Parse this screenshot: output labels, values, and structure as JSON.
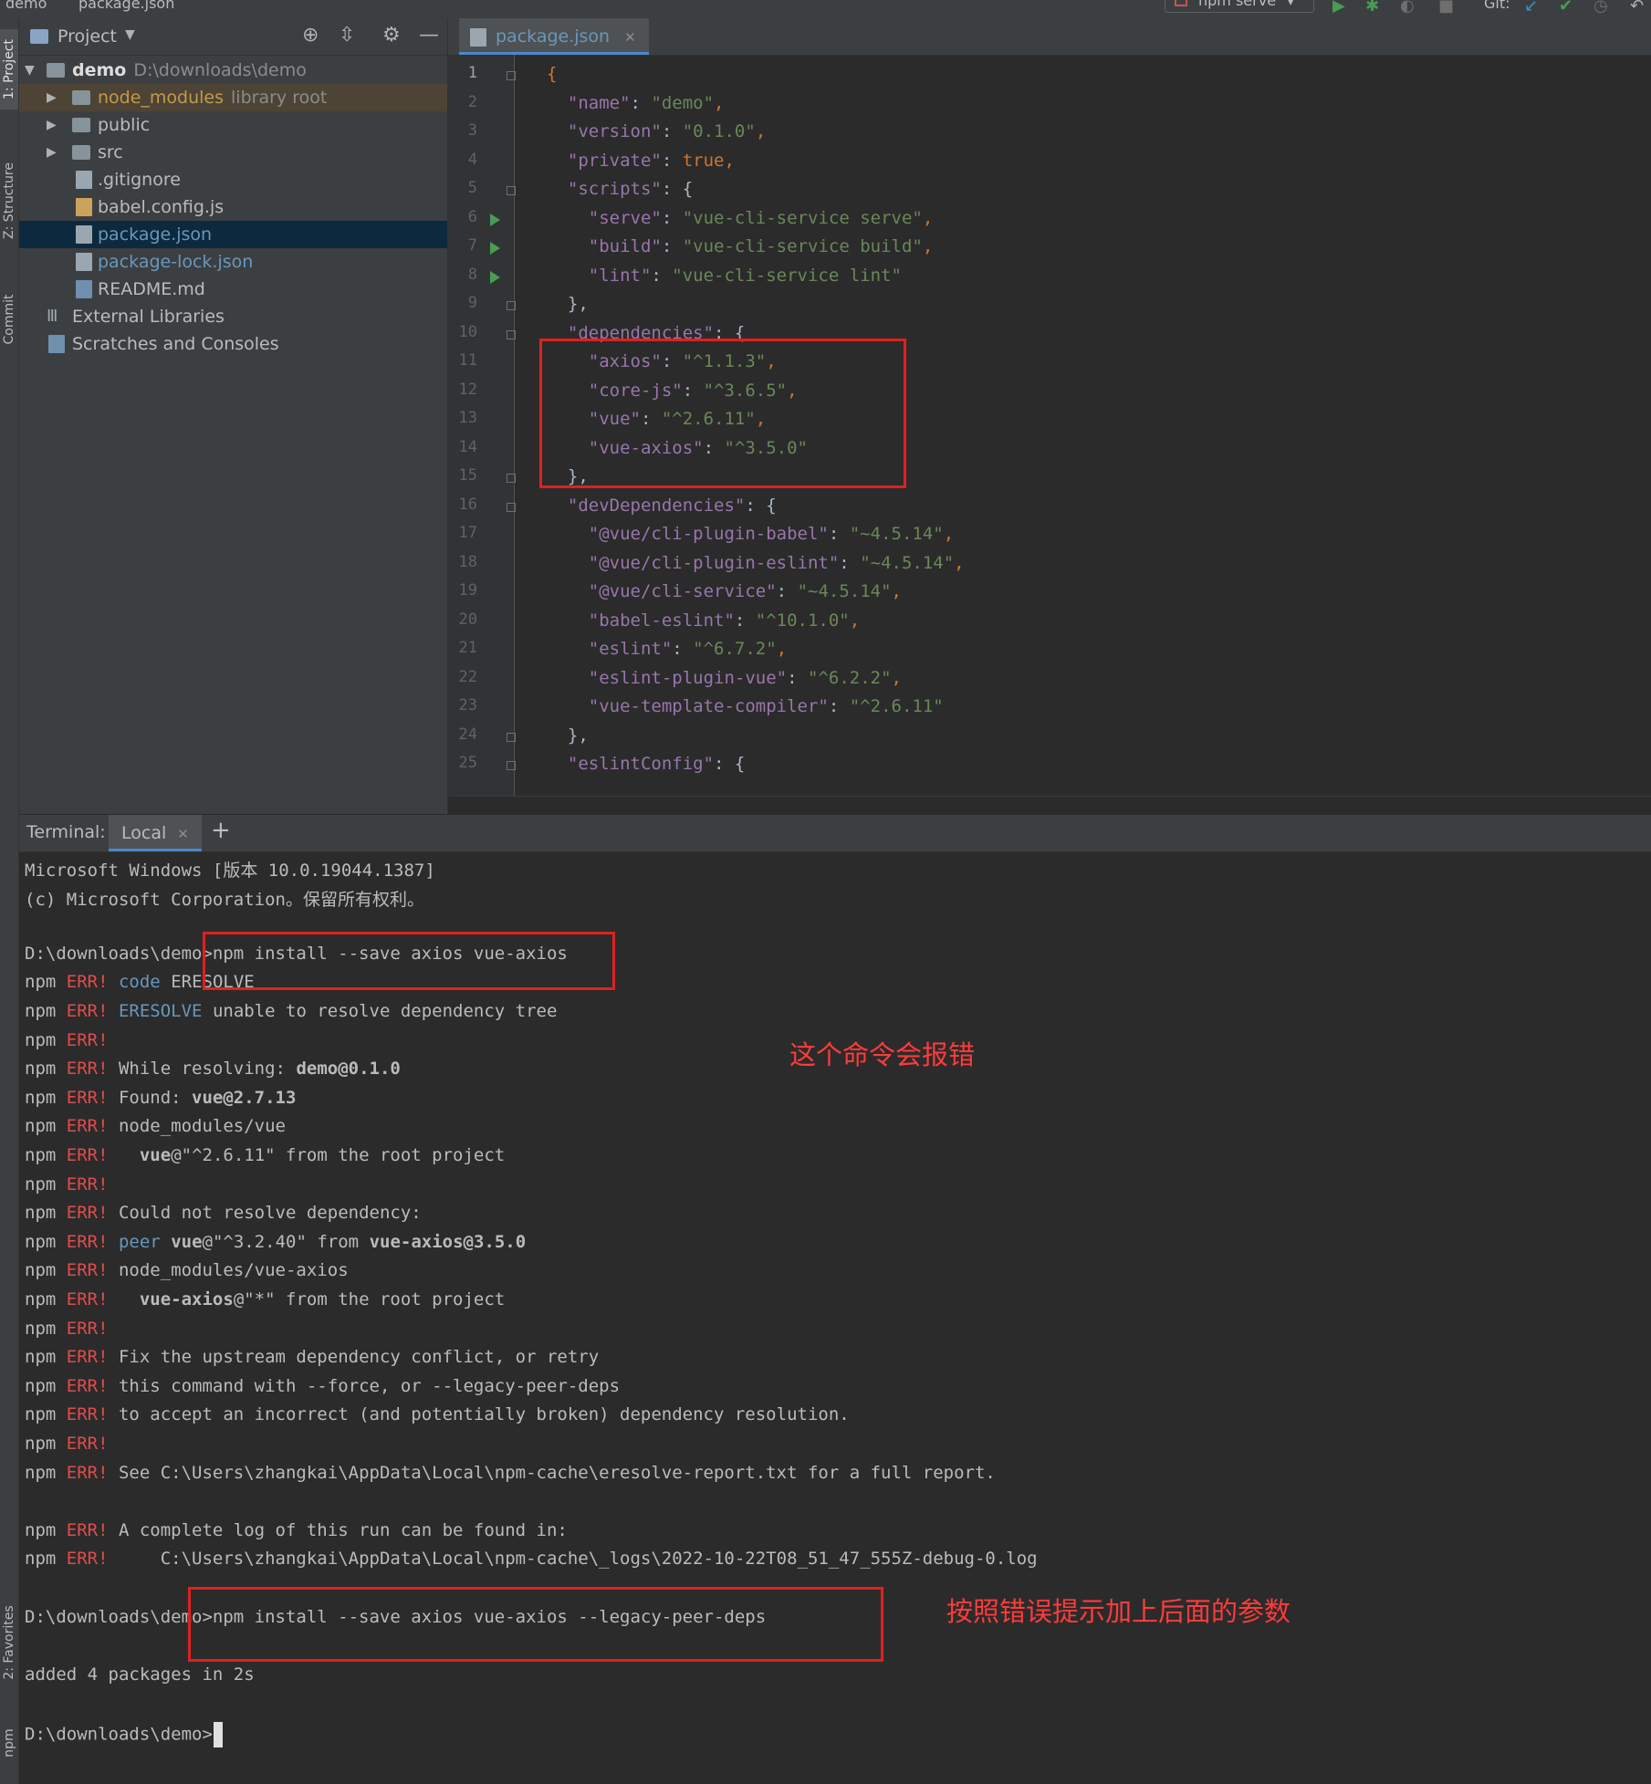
{
  "window": {
    "breadcrumb_project": "demo",
    "breadcrumb_file": "package.json",
    "run_config": "npm serve",
    "git_label": "Git:"
  },
  "left_stripe": {
    "project": "1: Project",
    "structure": "Z: Structure",
    "commit": "Commit",
    "favorites": "2: Favorites",
    "npm": "npm"
  },
  "project_panel": {
    "title": "Project",
    "tree": [
      {
        "label": "demo",
        "hint": "D:\\downloads\\demo"
      },
      {
        "label": "node_modules",
        "hint": "library root"
      },
      {
        "label": "public"
      },
      {
        "label": "src"
      },
      {
        "label": ".gitignore"
      },
      {
        "label": "babel.config.js"
      },
      {
        "label": "package.json"
      },
      {
        "label": "package-lock.json"
      },
      {
        "label": "README.md"
      },
      {
        "label": "External Libraries"
      },
      {
        "label": "Scratches and Consoles"
      }
    ]
  },
  "editor": {
    "tab_label": "package.json",
    "line_numbers": [
      "1",
      "2",
      "3",
      "4",
      "5",
      "6",
      "7",
      "8",
      "9",
      "10",
      "11",
      "12",
      "13",
      "14",
      "15",
      "16",
      "17",
      "18",
      "19",
      "20",
      "21",
      "22",
      "23",
      "24",
      "25"
    ],
    "code": [
      [
        [
          "b",
          "{"
        ]
      ],
      [
        [
          "k",
          "  \"name\""
        ],
        [
          "t",
          ": "
        ],
        [
          "s",
          "\"demo\""
        ],
        [
          "p",
          ","
        ]
      ],
      [
        [
          "k",
          "  \"version\""
        ],
        [
          "t",
          ": "
        ],
        [
          "s",
          "\"0.1.0\""
        ],
        [
          "p",
          ","
        ]
      ],
      [
        [
          "k",
          "  \"private\""
        ],
        [
          "t",
          ": "
        ],
        [
          "p",
          "true,"
        ]
      ],
      [
        [
          "k",
          "  \"scripts\""
        ],
        [
          "t",
          ": {"
        ]
      ],
      [
        [
          "k",
          "    \"serve\""
        ],
        [
          "t",
          ": "
        ],
        [
          "s",
          "\"vue-cli-service serve\""
        ],
        [
          "p",
          ","
        ]
      ],
      [
        [
          "k",
          "    \"build\""
        ],
        [
          "t",
          ": "
        ],
        [
          "s",
          "\"vue-cli-service build\""
        ],
        [
          "p",
          ","
        ]
      ],
      [
        [
          "k",
          "    \"lint\""
        ],
        [
          "t",
          ": "
        ],
        [
          "s",
          "\"vue-cli-service lint\""
        ]
      ],
      [
        [
          "t",
          "  },"
        ]
      ],
      [
        [
          "k",
          "  \"dependencies\""
        ],
        [
          "t",
          ": {"
        ]
      ],
      [
        [
          "k",
          "    \"axios\""
        ],
        [
          "t",
          ": "
        ],
        [
          "s",
          "\"^1.1.3\""
        ],
        [
          "p",
          ","
        ]
      ],
      [
        [
          "k",
          "    \"core-js\""
        ],
        [
          "t",
          ": "
        ],
        [
          "s",
          "\"^3.6.5\""
        ],
        [
          "p",
          ","
        ]
      ],
      [
        [
          "k",
          "    \"vue\""
        ],
        [
          "t",
          ": "
        ],
        [
          "s",
          "\"^2.6.11\""
        ],
        [
          "p",
          ","
        ]
      ],
      [
        [
          "k",
          "    \"vue-axios\""
        ],
        [
          "t",
          ": "
        ],
        [
          "s",
          "\"^3.5.0\""
        ]
      ],
      [
        [
          "t",
          "  },"
        ]
      ],
      [
        [
          "k",
          "  \"devDependencies\""
        ],
        [
          "t",
          ": {"
        ]
      ],
      [
        [
          "k",
          "    \"@vue/cli-plugin-babel\""
        ],
        [
          "t",
          ": "
        ],
        [
          "s",
          "\"~4.5.14\""
        ],
        [
          "p",
          ","
        ]
      ],
      [
        [
          "k",
          "    \"@vue/cli-plugin-eslint\""
        ],
        [
          "t",
          ": "
        ],
        [
          "s",
          "\"~4.5.14\""
        ],
        [
          "p",
          ","
        ]
      ],
      [
        [
          "k",
          "    \"@vue/cli-service\""
        ],
        [
          "t",
          ": "
        ],
        [
          "s",
          "\"~4.5.14\""
        ],
        [
          "p",
          ","
        ]
      ],
      [
        [
          "k",
          "    \"babel-eslint\""
        ],
        [
          "t",
          ": "
        ],
        [
          "s",
          "\"^10.1.0\""
        ],
        [
          "p",
          ","
        ]
      ],
      [
        [
          "k",
          "    \"eslint\""
        ],
        [
          "t",
          ": "
        ],
        [
          "s",
          "\"^6.7.2\""
        ],
        [
          "p",
          ","
        ]
      ],
      [
        [
          "k",
          "    \"eslint-plugin-vue\""
        ],
        [
          "t",
          ": "
        ],
        [
          "s",
          "\"^6.2.2\""
        ],
        [
          "p",
          ","
        ]
      ],
      [
        [
          "k",
          "    \"vue-template-compiler\""
        ],
        [
          "t",
          ": "
        ],
        [
          "s",
          "\"^2.6.11\""
        ]
      ],
      [
        [
          "t",
          "  },"
        ]
      ],
      [
        [
          "k",
          "  \"eslintConfig\""
        ],
        [
          "t",
          ": {"
        ]
      ]
    ]
  },
  "terminal": {
    "label": "Terminal:",
    "tab": "Local",
    "lines": [
      [
        [
          "",
          "Microsoft Windows [版本 10.0.19044.1387]"
        ]
      ],
      [
        [
          "",
          "(c) Microsoft Corporation。保留所有权利。"
        ]
      ],
      [
        [
          "",
          ""
        ]
      ],
      [
        [
          "",
          "D:\\downloads\\demo>npm install --save axios vue-axios"
        ]
      ],
      [
        [
          "",
          "npm "
        ],
        [
          "err",
          "ERR!"
        ],
        [
          "",
          " "
        ],
        [
          "kw",
          "code"
        ],
        [
          "",
          " ERESOLVE"
        ]
      ],
      [
        [
          "",
          "npm "
        ],
        [
          "err",
          "ERR!"
        ],
        [
          "",
          " "
        ],
        [
          "kw",
          "ERESOLVE"
        ],
        [
          "",
          " unable to resolve dependency tree"
        ]
      ],
      [
        [
          "",
          "npm "
        ],
        [
          "err",
          "ERR!"
        ]
      ],
      [
        [
          "",
          "npm "
        ],
        [
          "err",
          "ERR!"
        ],
        [
          "",
          " While resolving: "
        ],
        [
          "bold",
          "demo@0.1.0"
        ]
      ],
      [
        [
          "",
          "npm "
        ],
        [
          "err",
          "ERR!"
        ],
        [
          "",
          " Found: "
        ],
        [
          "bold",
          "vue@2.7.13"
        ]
      ],
      [
        [
          "",
          "npm "
        ],
        [
          "err",
          "ERR!"
        ],
        [
          "",
          " node_modules/vue"
        ]
      ],
      [
        [
          "",
          "npm "
        ],
        [
          "err",
          "ERR!"
        ],
        [
          "",
          "   "
        ],
        [
          "bold",
          "vue"
        ],
        [
          "",
          "@\"^2.6.11\" from the root project"
        ]
      ],
      [
        [
          "",
          "npm "
        ],
        [
          "err",
          "ERR!"
        ]
      ],
      [
        [
          "",
          "npm "
        ],
        [
          "err",
          "ERR!"
        ],
        [
          "",
          " Could not resolve dependency:"
        ]
      ],
      [
        [
          "",
          "npm "
        ],
        [
          "err",
          "ERR!"
        ],
        [
          "",
          " "
        ],
        [
          "kw",
          "peer"
        ],
        [
          "",
          " "
        ],
        [
          "bold",
          "vue"
        ],
        [
          "",
          "@\"^3.2.40\" from "
        ],
        [
          "bold",
          "vue-axios@3.5.0"
        ]
      ],
      [
        [
          "",
          "npm "
        ],
        [
          "err",
          "ERR!"
        ],
        [
          "",
          " node_modules/vue-axios"
        ]
      ],
      [
        [
          "",
          "npm "
        ],
        [
          "err",
          "ERR!"
        ],
        [
          "",
          "   "
        ],
        [
          "bold",
          "vue-axios"
        ],
        [
          "",
          "@\"*\" from the root project"
        ]
      ],
      [
        [
          "",
          "npm "
        ],
        [
          "err",
          "ERR!"
        ]
      ],
      [
        [
          "",
          "npm "
        ],
        [
          "err",
          "ERR!"
        ],
        [
          "",
          " Fix the upstream dependency conflict, or retry"
        ]
      ],
      [
        [
          "",
          "npm "
        ],
        [
          "err",
          "ERR!"
        ],
        [
          "",
          " this command with --force, or --legacy-peer-deps"
        ]
      ],
      [
        [
          "",
          "npm "
        ],
        [
          "err",
          "ERR!"
        ],
        [
          "",
          " to accept an incorrect (and potentially broken) dependency resolution."
        ]
      ],
      [
        [
          "",
          "npm "
        ],
        [
          "err",
          "ERR!"
        ]
      ],
      [
        [
          "",
          "npm "
        ],
        [
          "err",
          "ERR!"
        ],
        [
          "",
          " See C:\\Users\\zhangkai\\AppData\\Local\\npm-cache\\eresolve-report.txt for a full report."
        ]
      ],
      [
        [
          "",
          ""
        ]
      ],
      [
        [
          "",
          "npm "
        ],
        [
          "err",
          "ERR!"
        ],
        [
          "",
          " A complete log of this run can be found in:"
        ]
      ],
      [
        [
          "",
          "npm "
        ],
        [
          "err",
          "ERR!"
        ],
        [
          "",
          "     C:\\Users\\zhangkai\\AppData\\Local\\npm-cache\\_logs\\2022-10-22T08_51_47_555Z-debug-0.log"
        ]
      ],
      [
        [
          "",
          ""
        ]
      ],
      [
        [
          "",
          "D:\\downloads\\demo>npm install --save axios vue-axios --legacy-peer-deps"
        ]
      ],
      [
        [
          "",
          ""
        ]
      ],
      [
        [
          "",
          "added 4 packages in 2s"
        ]
      ],
      [
        [
          "",
          ""
        ]
      ],
      [
        [
          "",
          "D:\\downloads\\demo>"
        ]
      ]
    ],
    "annotation_1": "这个命令会报错",
    "annotation_2": "按照错误提示加上后面的参数"
  },
  "colors": {
    "error_red": "#e24b4b",
    "annotation_red": "#ff3b3b",
    "json_key": "#9876aa",
    "json_string": "#6a8759",
    "keyword_orange": "#cc7832"
  }
}
